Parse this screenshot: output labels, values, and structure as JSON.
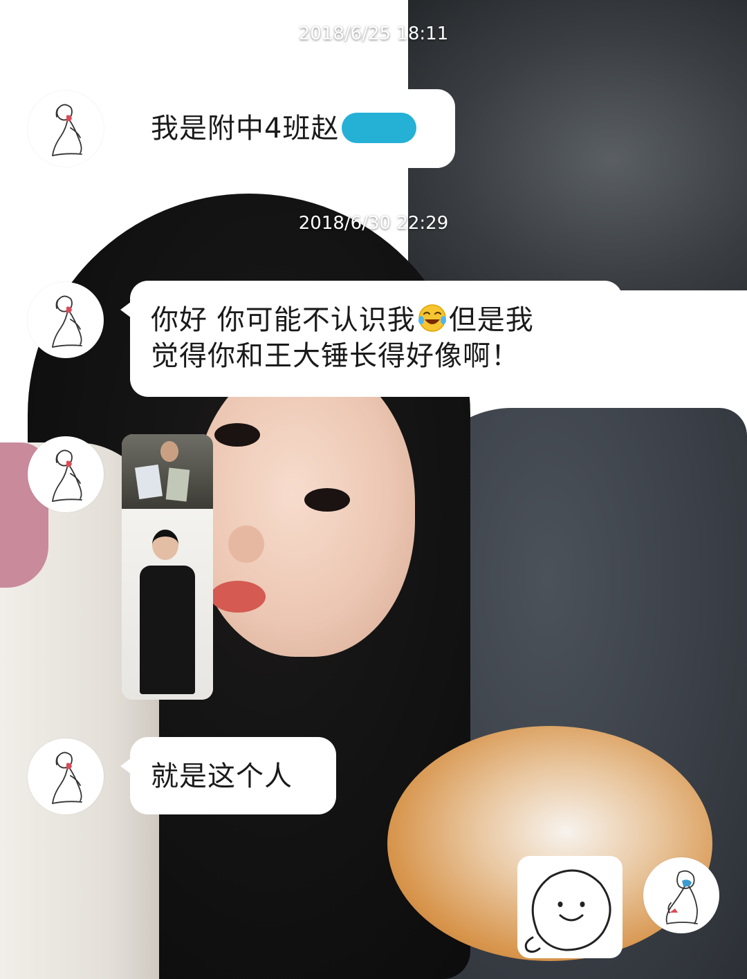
{
  "chat": {
    "timestamps": [
      "2018/6/25 18:11",
      "2018/6/30 22:29"
    ],
    "messages": [
      {
        "sender": "contact",
        "text": "我是附中4班赵",
        "note": "name partially redacted"
      },
      {
        "sender": "contact",
        "line1a": "你好 你可能不认识我",
        "line1b": "但是我",
        "line2": "觉得你和王大锤长得好像啊！",
        "emoji": "face-with-tears-of-joy"
      },
      {
        "sender": "contact",
        "type": "image"
      },
      {
        "sender": "contact",
        "text": "就是这个人"
      },
      {
        "sender": "self",
        "type": "sticker",
        "sticker": "smiling-round-face-sticker"
      }
    ]
  },
  "colors": {
    "bubble": "#ffffff",
    "text": "#1a1a1a",
    "timestamp": "#ffffff",
    "redaction": "#25b0d6"
  }
}
